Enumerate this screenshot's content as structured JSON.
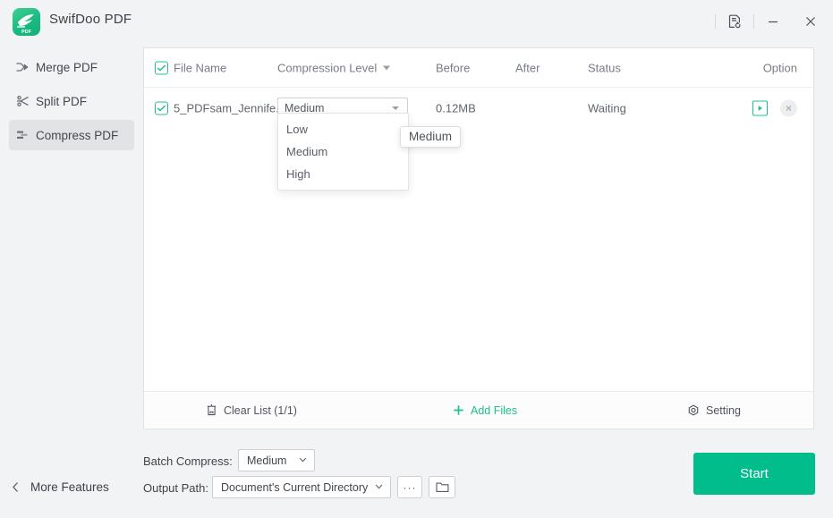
{
  "window": {
    "title": "SwifDoo PDF",
    "logo_icon": "swifdoo-bird-logo",
    "controls": [
      {
        "name": "feedback-icon",
        "glyph": "document-refresh"
      },
      {
        "name": "minimize-icon",
        "glyph": "minimize"
      },
      {
        "name": "close-icon",
        "glyph": "close"
      }
    ]
  },
  "sidebar": {
    "items": [
      {
        "label": "Merge PDF",
        "icon": "merge-icon",
        "active": false
      },
      {
        "label": "Split PDF",
        "icon": "split-icon",
        "active": false
      },
      {
        "label": "Compress PDF",
        "icon": "compress-icon",
        "active": true
      }
    ],
    "more_features": {
      "label": "More Features",
      "icon": "chevron-left-icon"
    }
  },
  "table": {
    "headers": {
      "file_name": "File Name",
      "compression_level": "Compression Level",
      "before": "Before",
      "after": "After",
      "status": "Status",
      "option": "Option"
    },
    "rows": [
      {
        "checked": true,
        "file_name": "5_PDFsam_Jennife...",
        "compression_level": "Medium",
        "before": "0.12MB",
        "after": "",
        "status": "Waiting"
      }
    ]
  },
  "dropdown": {
    "open": true,
    "selected": "Medium",
    "options": [
      "Low",
      "Medium",
      "High"
    ]
  },
  "tooltip": {
    "text": "Medium"
  },
  "card_footer": {
    "clear_list": "Clear List (1/1)",
    "add_files": "Add Files",
    "setting": "Setting"
  },
  "bottom": {
    "batch_compress_label": "Batch Compress:",
    "batch_compress_value": "Medium",
    "output_path_label": "Output Path:",
    "output_path_value": "Document's Current Directory",
    "browse_dots_label": "···",
    "folder_icon": "folder-icon",
    "start_label": "Start"
  },
  "colors": {
    "accent": "#00bd8b",
    "accent_light": "#1ec08c",
    "window_bg": "#f2f3f5",
    "card_bg": "#ffffff",
    "text": "#434750"
  }
}
